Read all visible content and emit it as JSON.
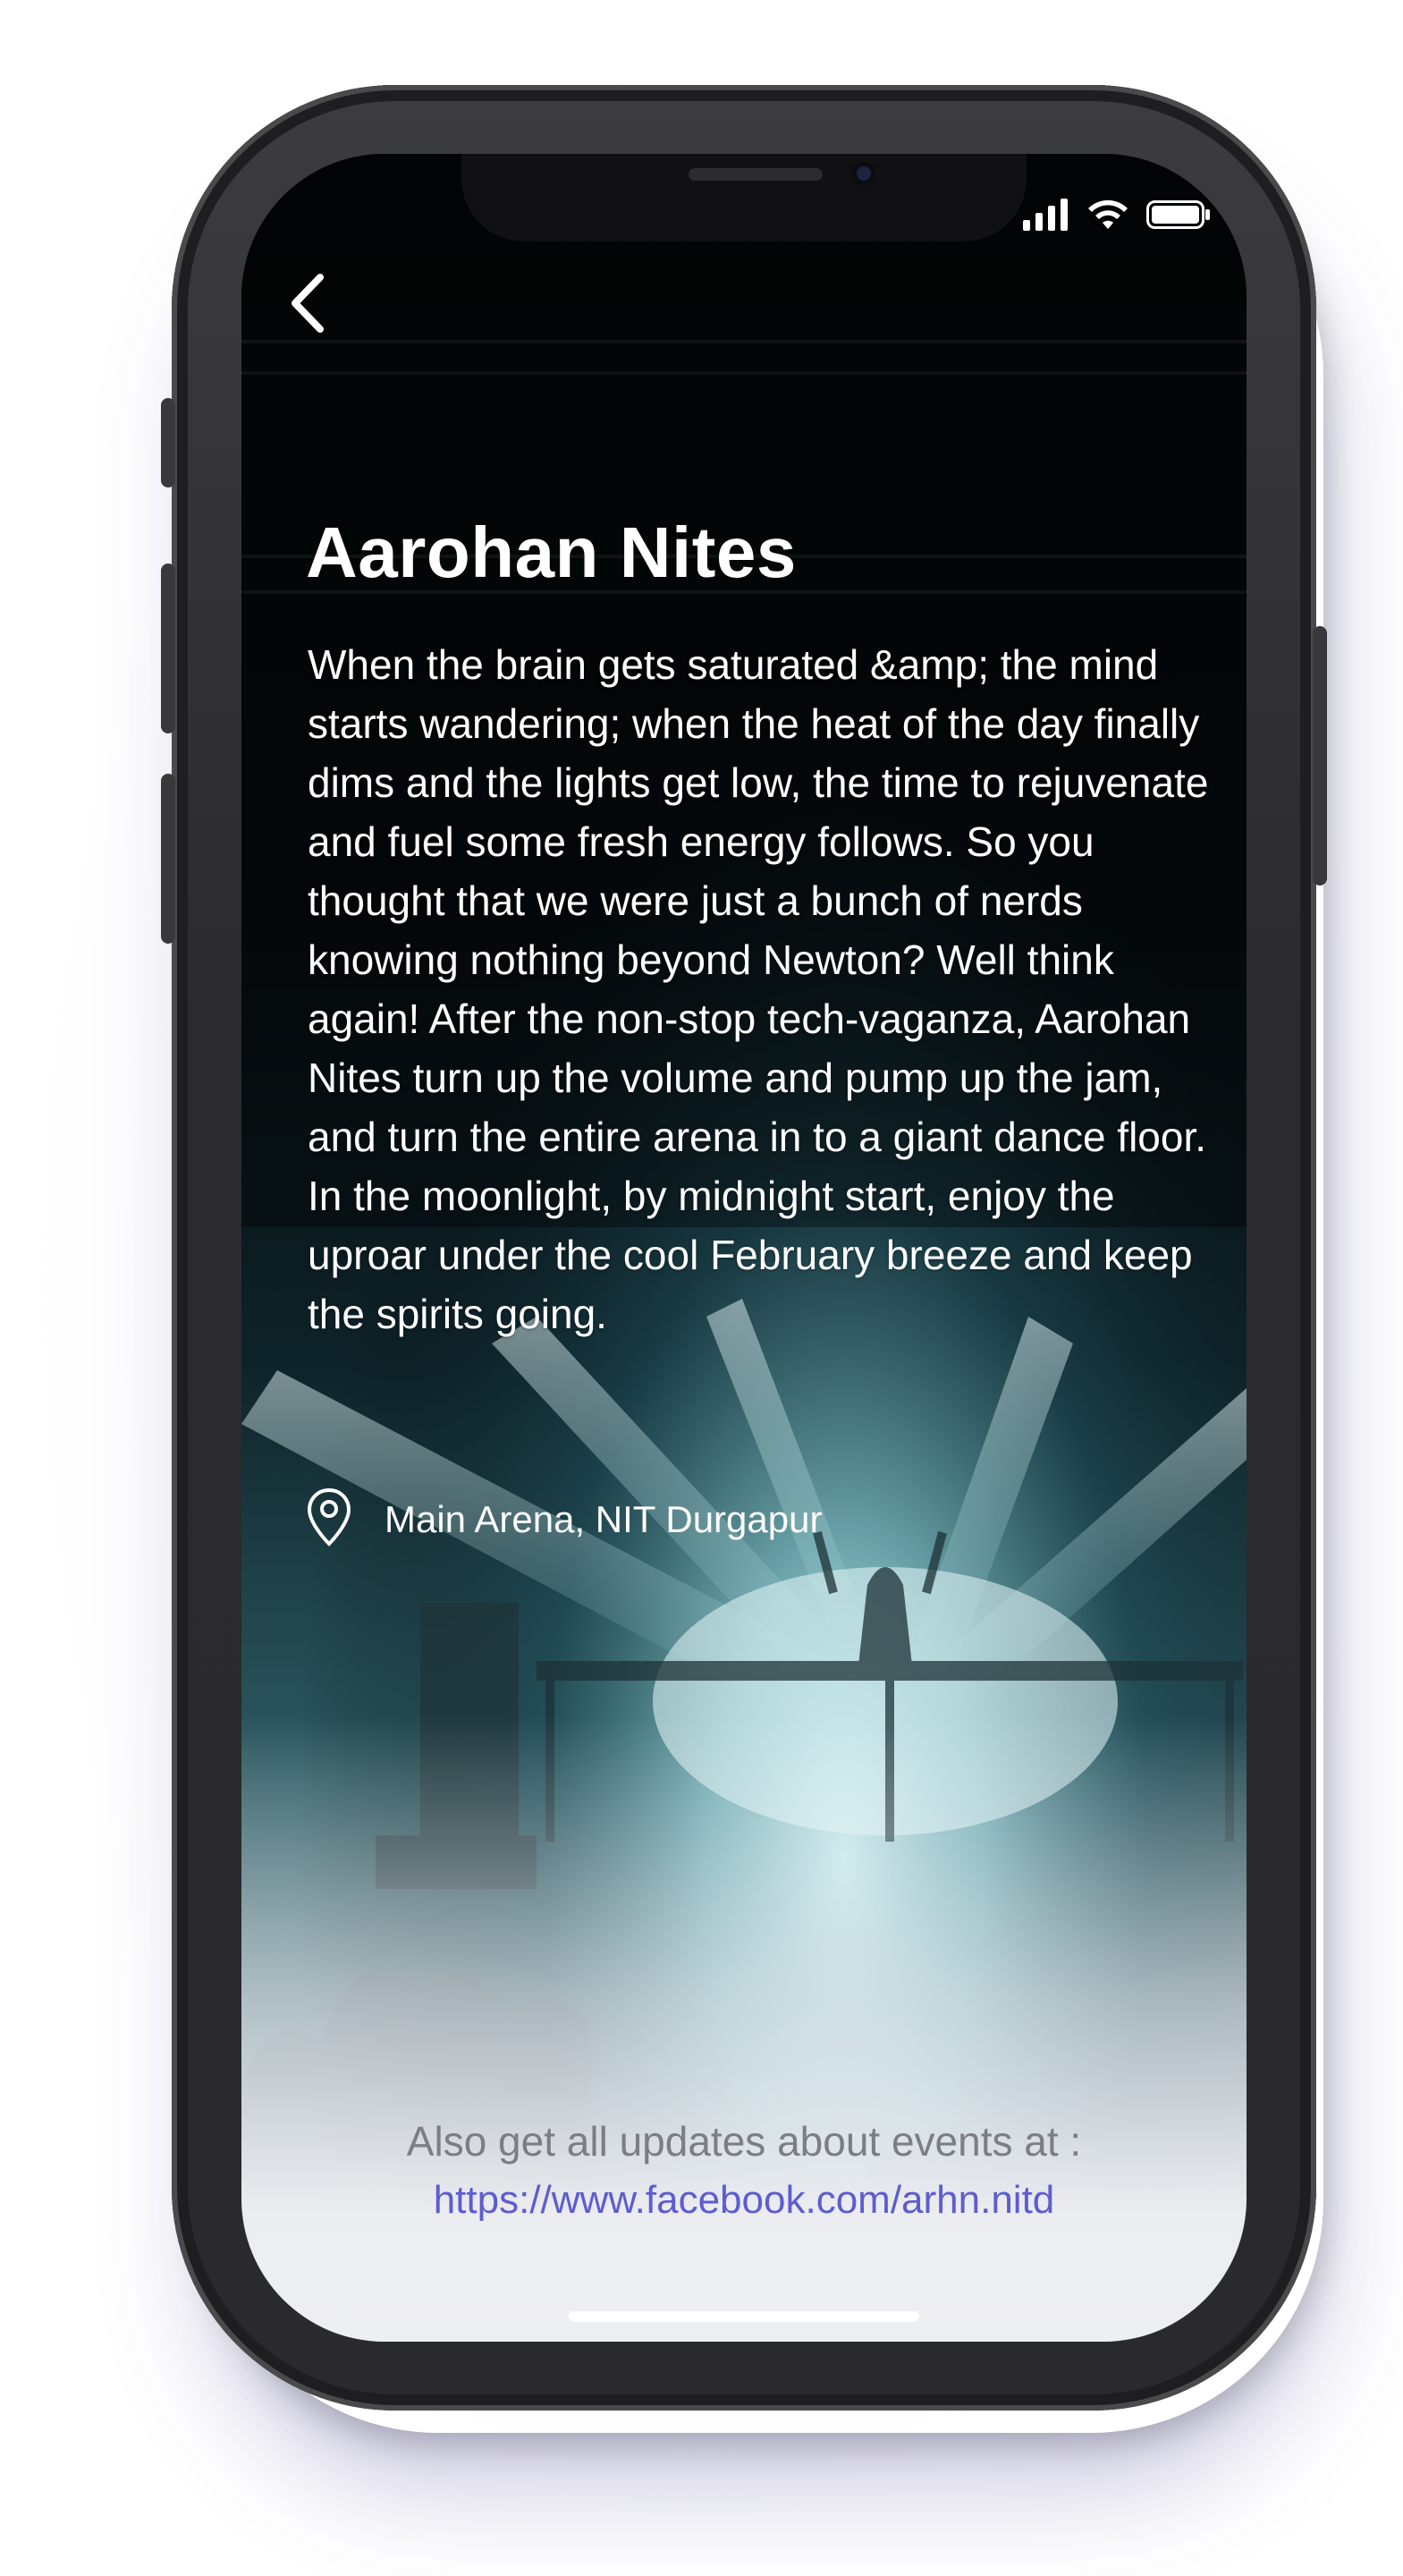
{
  "event": {
    "title": "Aarohan Nites",
    "description": "When the brain gets saturated &amp; the mind starts wandering; when the heat of the day finally dims and the lights get low, the time to rejuvenate and fuel some fresh energy follows. So you thought that we were just a bunch of nerds knowing nothing beyond Newton? Well think again! After the non-stop tech-vaganza, Aarohan Nites turn up the volume and pump up the jam, and turn the entire arena in to a giant dance floor. In the moonlight, by midnight start, enjoy the uproar under the cool February breeze and keep the spirits going.",
    "location": "Main Arena, NIT Durgapur"
  },
  "footer": {
    "text": "Also get all updates about events at :",
    "link": "https://www.facebook.com/arhn.nitd"
  },
  "icons": {
    "back": "chevron-left-icon",
    "location": "map-pin-icon",
    "signal": "cellular-signal-icon",
    "wifi": "wifi-icon",
    "battery": "battery-icon"
  },
  "colors": {
    "background_dark": "#05090b",
    "stage_light": "#b9e3e6",
    "link": "#5d5dd0",
    "footer_text": "#7d7d84"
  }
}
